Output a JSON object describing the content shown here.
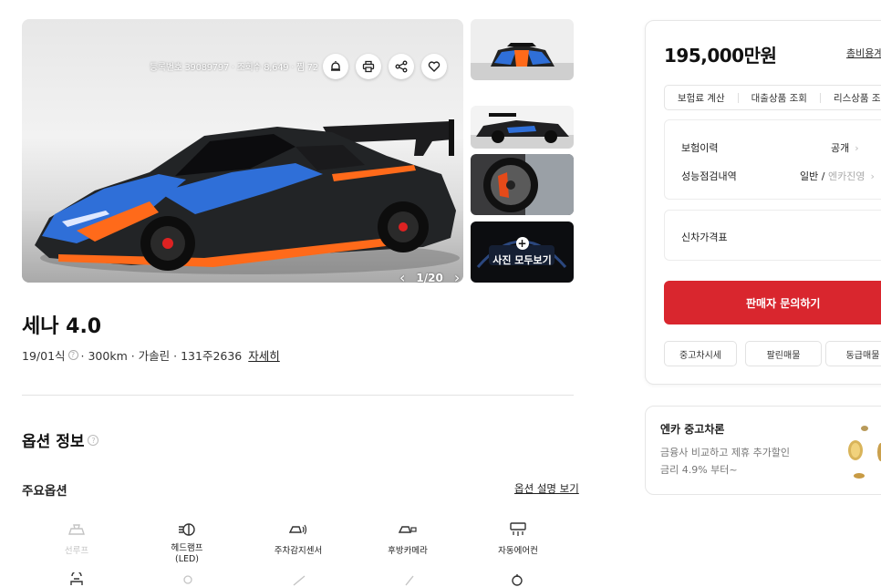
{
  "gallery": {
    "meta": "등록번호 39089797 · 조회수 8,649 · 찜 72",
    "counter": "1/20",
    "prev_arrow": "‹",
    "next_arrow": "›",
    "view_all_label": "사진 모두보기",
    "action_icons": [
      "alarm-icon",
      "print-icon",
      "share-icon",
      "heart-icon"
    ]
  },
  "car": {
    "title": "세나 4.0",
    "specs": "19/01식",
    "specs_rest": "· 300km · 가솔린 · 131주2636",
    "detail_link": "자세히"
  },
  "options": {
    "section_title": "옵션 정보",
    "main_title": "주요옵션",
    "guide_link": "옵션 설명 보기",
    "items": [
      {
        "label": "선루프",
        "icon": "sunroof-icon",
        "enabled": false
      },
      {
        "label": "헤드램프\n(LED)",
        "icon": "headlamp-icon",
        "enabled": true
      },
      {
        "label": "주차감지센서",
        "icon": "parking-sensor-icon",
        "enabled": true
      },
      {
        "label": "후방카메라",
        "icon": "rear-camera-icon",
        "enabled": true
      },
      {
        "label": "자동에어컨",
        "icon": "auto-aircon-icon",
        "enabled": true
      }
    ]
  },
  "price_card": {
    "price": "195,000만원",
    "cost_link": "총비용계산",
    "quick_links": [
      "보험료 계산",
      "대출상품 조회",
      "리스상품 조회"
    ],
    "insurance_label": "보험이력",
    "insurance_value": "공개",
    "inspection_label": "성능점검내역",
    "inspection_value": "일반",
    "inspection_value_muted": "엔카진영",
    "newcar_label": "신차가격표",
    "cta_label": "판매자 문의하기",
    "mini_buttons": [
      "중고차시세",
      "팔린매물",
      "동급매물"
    ]
  },
  "loan_card": {
    "title": "엔카 중고차론",
    "desc_line1": "금융사 비교하고 제휴 추가할인",
    "desc_line2": "금리 4.9% 부터~"
  },
  "colors": {
    "accent_red": "#d9262e",
    "car_blue": "#2f6fd8",
    "car_orange": "#ff6a1a"
  }
}
